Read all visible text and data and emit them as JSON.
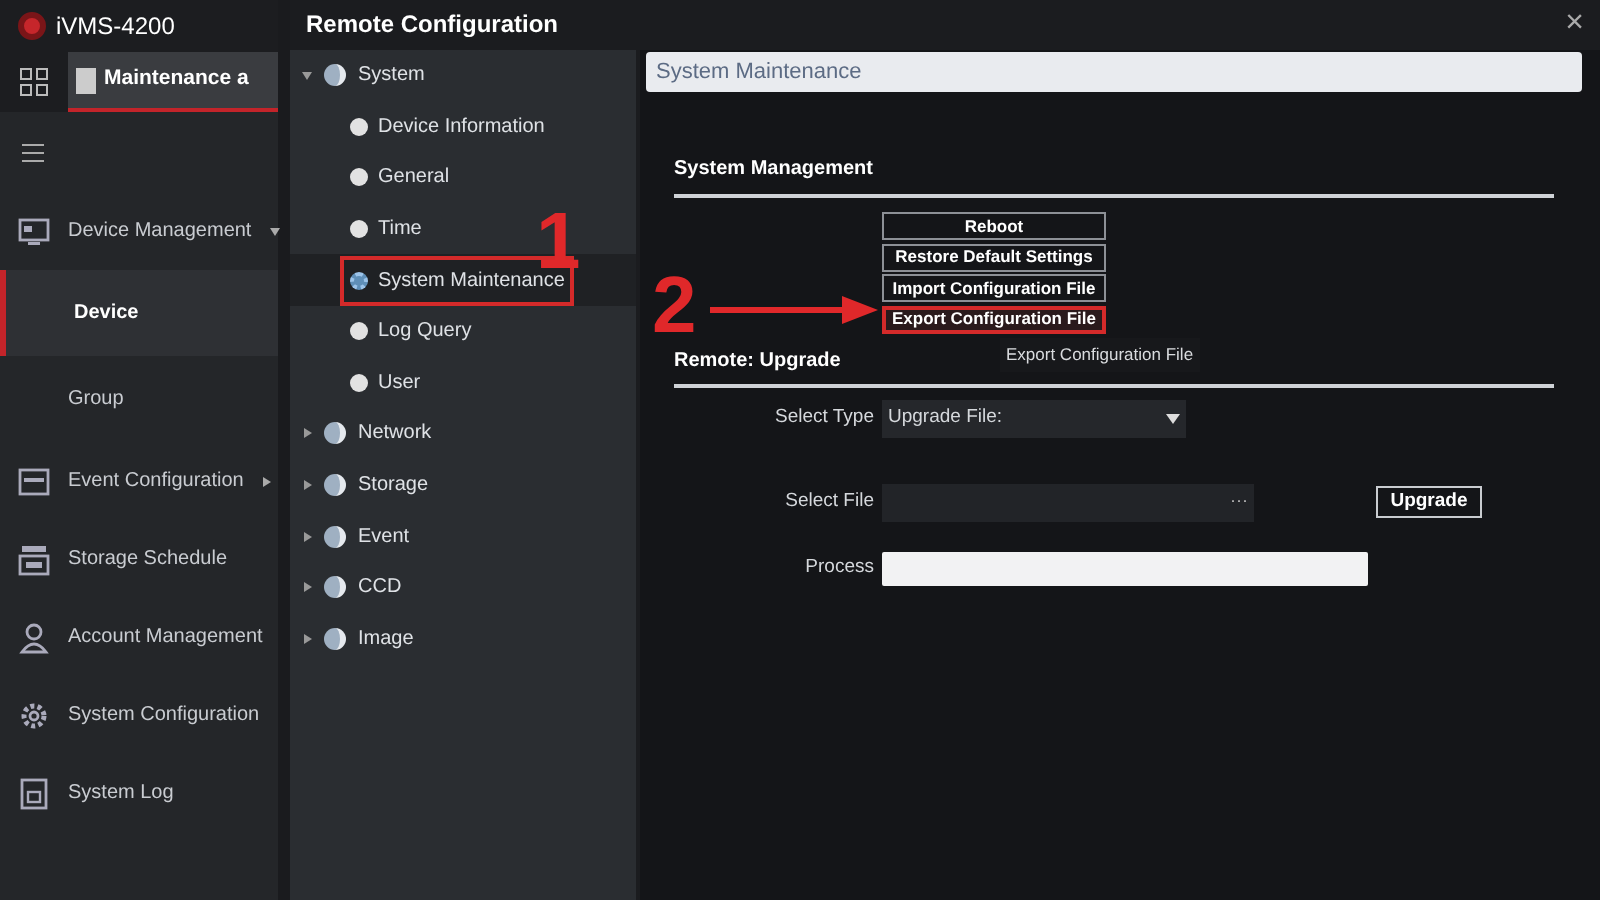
{
  "app": {
    "logo_text": "iVMS-4200",
    "tab": {
      "label": "Maintenance a",
      "selected": true
    }
  },
  "sidebar": {
    "items": [
      {
        "label": "Device Management",
        "selected": false,
        "expanded": true,
        "children": [
          {
            "label": "Device",
            "selected": true
          },
          {
            "label": "Group",
            "selected": false
          }
        ]
      },
      {
        "label": "Event Configuration",
        "selected": false,
        "expanded": false
      },
      {
        "label": "Storage Schedule",
        "selected": false
      },
      {
        "label": "Account Management",
        "selected": false
      },
      {
        "label": "System Configuration",
        "selected": false
      },
      {
        "label": "System Log",
        "selected": false
      }
    ]
  },
  "dialog": {
    "title": "Remote Configuration",
    "close": "×",
    "tree": [
      {
        "label": "System",
        "expanded": true,
        "children": [
          {
            "label": "Device Information",
            "selected": false,
            "highlighted": false
          },
          {
            "label": "General",
            "selected": false,
            "highlighted": false
          },
          {
            "label": "Time",
            "selected": false,
            "highlighted": false
          },
          {
            "label": "System Maintenance",
            "selected": true,
            "highlighted": true
          },
          {
            "label": "Log Query",
            "selected": false,
            "highlighted": false
          },
          {
            "label": "User",
            "selected": false,
            "highlighted": false
          }
        ]
      },
      {
        "label": "Network",
        "expanded": false
      },
      {
        "label": "Storage",
        "expanded": false
      },
      {
        "label": "Event",
        "expanded": false
      },
      {
        "label": "CCD",
        "expanded": false
      },
      {
        "label": "Image",
        "expanded": false
      }
    ],
    "panel_title": "System Maintenance",
    "system_management": {
      "heading": "System Management",
      "buttons": [
        {
          "label": "Reboot",
          "highlighted": false
        },
        {
          "label": "Restore Default Settings",
          "highlighted": false
        },
        {
          "label": "Import Configuration File",
          "highlighted": false
        },
        {
          "label": "Export Configuration File",
          "highlighted": true
        }
      ],
      "tooltip": "Export Configuration File"
    },
    "remote_upgrade": {
      "heading": "Remote: Upgrade",
      "select_type": {
        "label": "Select Type",
        "value": "Upgrade File:"
      },
      "select_file": {
        "label": "Select File",
        "browse": "···"
      },
      "upgrade_button": "Upgrade",
      "process": {
        "label": "Process",
        "level": 0
      }
    }
  },
  "annotations": [
    {
      "label": "1",
      "arrow": false
    },
    {
      "label": "2",
      "arrow": true
    }
  ]
}
